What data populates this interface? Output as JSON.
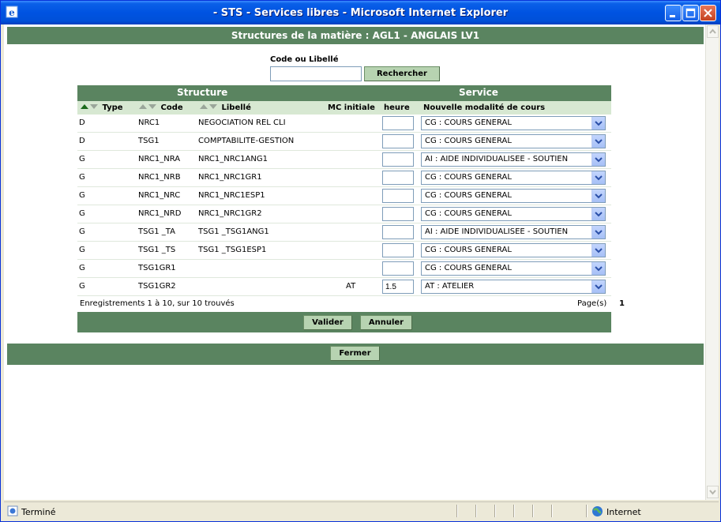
{
  "window": {
    "title": "- STS - Services libres - Microsoft Internet Explorer"
  },
  "page": {
    "header": "Structures de la matière : AGL1  - ANGLAIS LV1",
    "search": {
      "label": "Code ou Libellé",
      "value": "",
      "button": "Rechercher"
    },
    "groups": {
      "structure": "Structure",
      "service": "Service"
    },
    "columns": {
      "type": "Type",
      "code": "Code",
      "libelle": "Libellé",
      "mc_initiale": "MC initiale",
      "heure": "heure",
      "modalite": "Nouvelle modalité de cours"
    },
    "rows": [
      {
        "type": "D",
        "code": "NRC1",
        "libelle": "NEGOCIATION REL CLI",
        "mc": "",
        "heure": "",
        "modalite": "CG : COURS GENERAL"
      },
      {
        "type": "D",
        "code": "TSG1",
        "libelle": "COMPTABILITE-GESTION",
        "mc": "",
        "heure": "",
        "modalite": "CG : COURS GENERAL"
      },
      {
        "type": "G",
        "code": "NRC1_NRA",
        "libelle": "NRC1_NRC1ANG1",
        "mc": "",
        "heure": "",
        "modalite": "AI : AIDE INDIVIDUALISEE - SOUTIEN"
      },
      {
        "type": "G",
        "code": "NRC1_NRB",
        "libelle": "NRC1_NRC1GR1",
        "mc": "",
        "heure": "",
        "modalite": "CG : COURS GENERAL"
      },
      {
        "type": "G",
        "code": "NRC1_NRC",
        "libelle": "NRC1_NRC1ESP1",
        "mc": "",
        "heure": "",
        "modalite": "CG : COURS GENERAL"
      },
      {
        "type": "G",
        "code": "NRC1_NRD",
        "libelle": "NRC1_NRC1GR2",
        "mc": "",
        "heure": "",
        "modalite": "CG : COURS GENERAL"
      },
      {
        "type": "G",
        "code": "TSG1 _TA",
        "libelle": "TSG1 _TSG1ANG1",
        "mc": "",
        "heure": "",
        "modalite": "AI : AIDE INDIVIDUALISEE - SOUTIEN"
      },
      {
        "type": "G",
        "code": "TSG1 _TS",
        "libelle": "TSG1 _TSG1ESP1",
        "mc": "",
        "heure": "",
        "modalite": "CG : COURS GENERAL"
      },
      {
        "type": "G",
        "code": "TSG1GR1",
        "libelle": "",
        "mc": "",
        "heure": "",
        "modalite": "CG : COURS GENERAL"
      },
      {
        "type": "G",
        "code": "TSG1GR2",
        "libelle": "",
        "mc": "AT",
        "heure": "1.5",
        "modalite": "AT : ATELIER"
      }
    ],
    "records_info": "Enregistrements 1 à 10, sur 10 trouvés",
    "pages_label": "Page(s)",
    "current_page": "1",
    "buttons": {
      "valider": "Valider",
      "annuler": "Annuler",
      "fermer": "Fermer"
    }
  },
  "statusbar": {
    "status": "Terminé",
    "zone": "Internet"
  },
  "colors": {
    "band": "#5a8460",
    "subheader": "#d7e8d2",
    "button": "#b7d3b1",
    "titlebar": "#0053e1"
  }
}
